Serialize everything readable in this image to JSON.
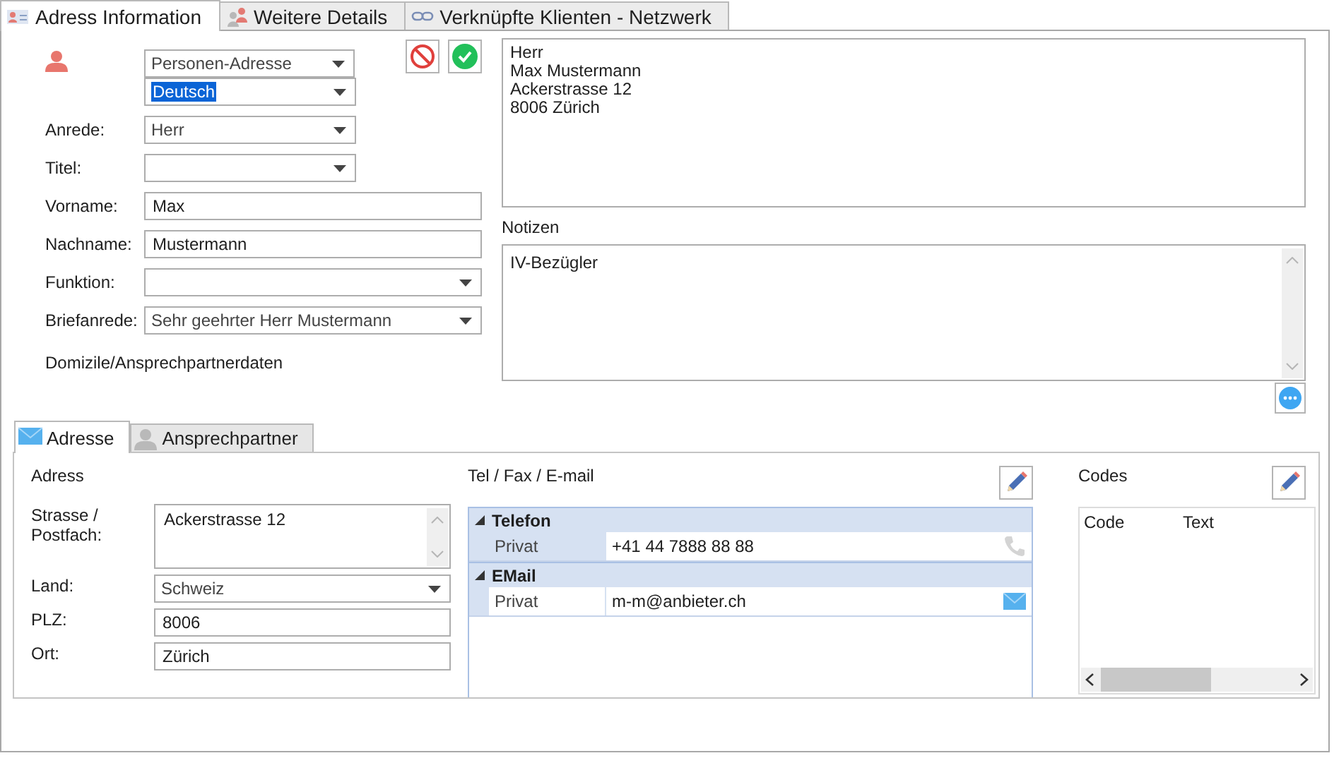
{
  "tabs": [
    {
      "label": "Adress Information",
      "selected": true
    },
    {
      "label": "Weitere Details",
      "selected": false
    },
    {
      "label": "Verknüpfte Klienten -  Netzwerk",
      "selected": false
    }
  ],
  "header": {
    "address_type": "Personen-Adresse",
    "language": {
      "value": "Deutsch",
      "highlighted": true
    }
  },
  "fields": [
    {
      "label": "Anrede:",
      "value": "Herr",
      "kind": "combo",
      "wide": false
    },
    {
      "label": "Titel:",
      "kind": "combo",
      "wide": false
    },
    {
      "label": "Vorname:",
      "value": "Max",
      "kind": "text",
      "wide": true
    },
    {
      "label": "Nachname:",
      "value": "Mustermann",
      "kind": "text",
      "wide": true
    },
    {
      "label": "Funktion:",
      "kind": "combo",
      "wide": true
    },
    {
      "label": "Briefanrede:",
      "value": "Sehr geehrter Herr Mustermann",
      "kind": "combo",
      "wide": true
    }
  ],
  "address_preview": {
    "lines": [
      "Herr",
      "Max Mustermann",
      "Ackerstrasse 12",
      "8006 Zürich"
    ]
  },
  "notes": {
    "label": "Notizen",
    "value": "IV-Bezügler"
  },
  "section_label": "Domizile/Ansprechpartnerdaten",
  "sub_tabs": [
    {
      "label": "Adresse",
      "selected": true
    },
    {
      "label": "Ansprechpartner",
      "selected": false
    }
  ],
  "address": {
    "title": "Adress",
    "fields": [
      {
        "label": "Strasse / Postfach:",
        "value": "Ackerstrasse 12",
        "kind": "memo"
      },
      {
        "label": "Land:",
        "value": "Schweiz",
        "kind": "combo"
      },
      {
        "label": "PLZ:",
        "value": "8006",
        "kind": "text"
      },
      {
        "label": "Ort:",
        "value": "Zürich",
        "kind": "text"
      }
    ]
  },
  "contacts": {
    "title": "Tel / Fax / E-mail",
    "groups": [
      {
        "name": "Telefon",
        "expanded": true,
        "kind": "phone",
        "rows": [
          {
            "label": "Privat",
            "value": "+41 44 7888 88 88",
            "selected": false
          }
        ]
      },
      {
        "name": "EMail",
        "expanded": true,
        "kind": "email",
        "rows": [
          {
            "label": "Privat",
            "value": "m-m@anbieter.ch",
            "selected": true
          }
        ]
      }
    ]
  },
  "codes": {
    "title": "Codes",
    "columns": [
      "Code",
      "Text"
    ]
  }
}
